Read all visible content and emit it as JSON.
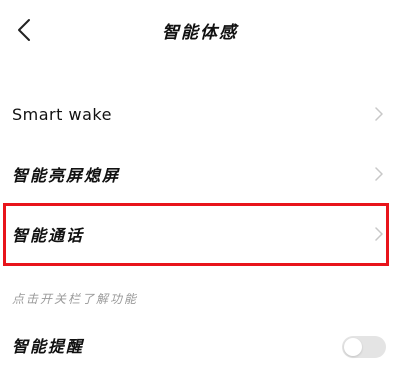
{
  "header": {
    "back_icon": "chevron-left-icon",
    "title": "智能体感"
  },
  "settings": {
    "items": [
      {
        "label": "Smart wake",
        "icon": "chevron-right-icon"
      },
      {
        "label": "智能亮屏熄屏",
        "icon": "chevron-right-icon"
      },
      {
        "label": "智能通话",
        "icon": "chevron-right-icon",
        "highlighted": true
      }
    ]
  },
  "hint": "点击开关栏了解功能",
  "toggle_row": {
    "label": "智能提醒",
    "enabled": false
  },
  "colors": {
    "highlight": "#e8141b",
    "hint_text": "#9a9a9a",
    "chevron": "#c8c8c8",
    "toggle_off": "#e4e4e4"
  }
}
